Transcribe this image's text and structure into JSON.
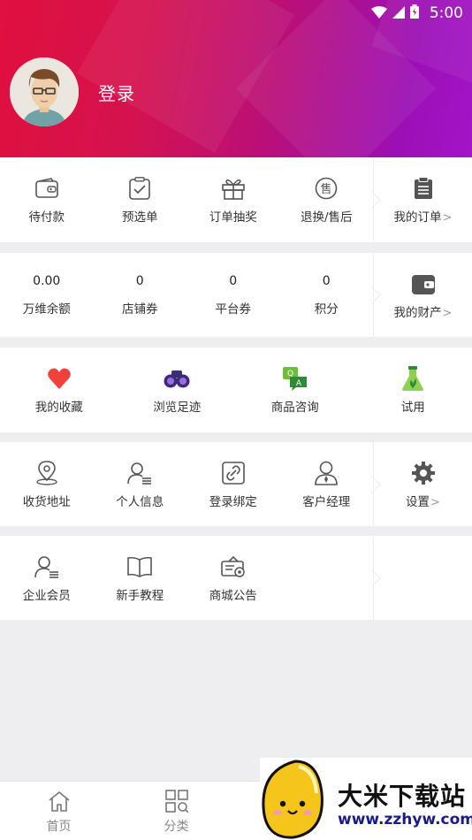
{
  "status_bar": {
    "time": "5:00"
  },
  "header": {
    "login_label": "登录"
  },
  "orders": {
    "items": [
      {
        "label": "待付款",
        "icon": "wallet-icon"
      },
      {
        "label": "预选单",
        "icon": "clipboard-check-icon"
      },
      {
        "label": "订单抽奖",
        "icon": "gift-icon"
      },
      {
        "label": "退换/售后",
        "icon": "after-sale-icon"
      }
    ],
    "side": {
      "label": "我的订单",
      "icon": "order-list-icon"
    }
  },
  "assets": {
    "items": [
      {
        "value": "0.00",
        "label": "万维余额"
      },
      {
        "value": "0",
        "label": "店铺券"
      },
      {
        "value": "0",
        "label": "平台券"
      },
      {
        "value": "0",
        "label": "积分"
      }
    ],
    "side": {
      "label": "我的财产",
      "icon": "wallet-icon"
    }
  },
  "features": {
    "items": [
      {
        "label": "我的收藏",
        "icon": "heart-icon"
      },
      {
        "label": "浏览足迹",
        "icon": "binoculars-icon"
      },
      {
        "label": "商品咨询",
        "icon": "chat-icon"
      },
      {
        "label": "试用",
        "icon": "flask-icon"
      }
    ]
  },
  "account": {
    "items": [
      {
        "label": "收货地址",
        "icon": "location-pin-icon"
      },
      {
        "label": "个人信息",
        "icon": "person-info-icon"
      },
      {
        "label": "登录绑定",
        "icon": "link-icon"
      },
      {
        "label": "客户经理",
        "icon": "manager-icon"
      }
    ],
    "side": {
      "label": "设置",
      "icon": "gear-icon"
    }
  },
  "more": {
    "items": [
      {
        "label": "企业会员",
        "icon": "enterprise-member-icon"
      },
      {
        "label": "新手教程",
        "icon": "book-icon"
      },
      {
        "label": "商城公告",
        "icon": "announcement-icon"
      }
    ]
  },
  "tabbar": {
    "tabs": [
      {
        "label": "首页",
        "icon": "home-icon"
      },
      {
        "label": "分类",
        "icon": "category-icon"
      }
    ]
  },
  "watermark": {
    "title": "大米下载站",
    "url": "www.zzhyw.com"
  },
  "colors": {
    "header_start": "#e0103f",
    "header_end": "#a414c8",
    "heart": "#f0413a",
    "purple_icon": "#3a2c78",
    "green_icon": "#6bbf3b"
  }
}
